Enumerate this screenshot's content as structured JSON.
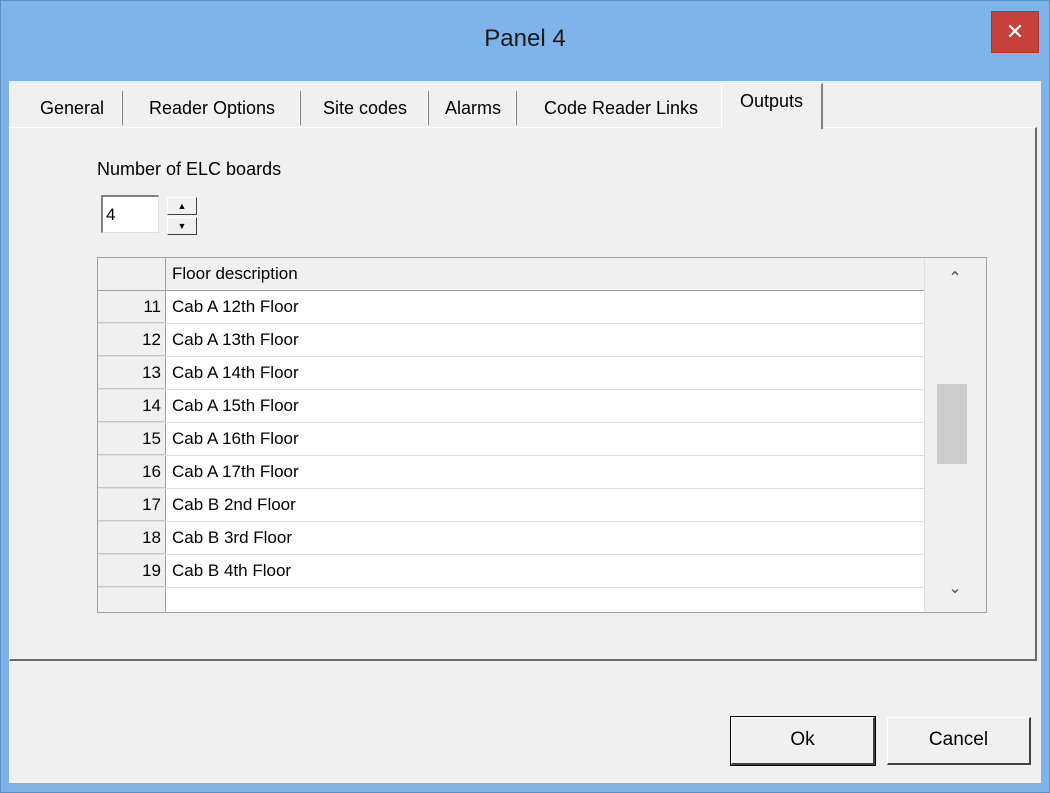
{
  "window": {
    "title": "Panel 4",
    "close_glyph": "✕"
  },
  "tabs": [
    {
      "label": "General"
    },
    {
      "label": "Reader Options"
    },
    {
      "label": "Site codes"
    },
    {
      "label": "Alarms"
    },
    {
      "label": "Code Reader Links"
    },
    {
      "label": "Outputs",
      "active": true
    }
  ],
  "outputs": {
    "elc_label": "Number of ELC boards",
    "elc_value": "4",
    "spin_up": "▲",
    "spin_down": "▼"
  },
  "grid": {
    "header": "Floor description",
    "rows": [
      {
        "num": "11",
        "desc": "Cab A 12th Floor"
      },
      {
        "num": "12",
        "desc": "Cab A 13th Floor"
      },
      {
        "num": "13",
        "desc": "Cab A 14th Floor"
      },
      {
        "num": "14",
        "desc": "Cab A 15th Floor"
      },
      {
        "num": "15",
        "desc": "Cab A 16th Floor"
      },
      {
        "num": "16",
        "desc": "Cab A 17th Floor"
      },
      {
        "num": "17",
        "desc": "Cab B 2nd Floor"
      },
      {
        "num": "18",
        "desc": "Cab B 3rd Floor"
      },
      {
        "num": "19",
        "desc": "Cab B 4th Floor"
      }
    ],
    "scroll_up_glyph": "⌃",
    "scroll_down_glyph": "⌄"
  },
  "buttons": {
    "ok": "Ok",
    "cancel": "Cancel"
  },
  "colors": {
    "titlebar": "#7eb4ea",
    "close": "#c7403a",
    "dialog": "#f0f0f0"
  }
}
